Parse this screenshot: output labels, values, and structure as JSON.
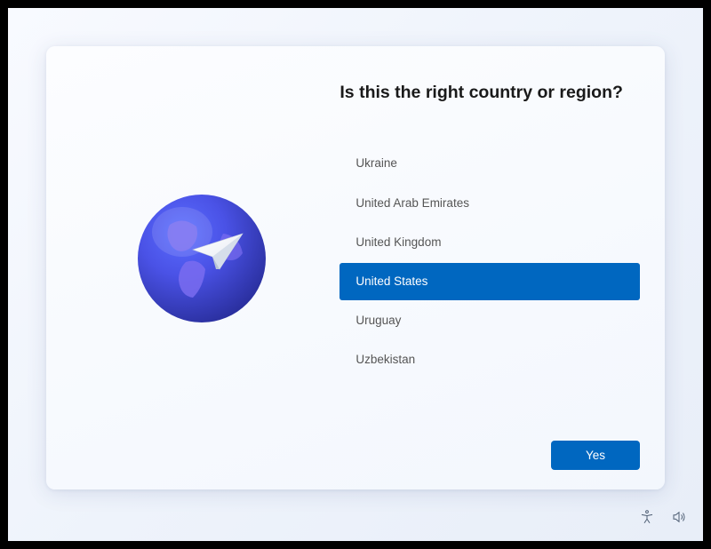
{
  "title": "Is this the right country or region?",
  "countries": {
    "items": [
      {
        "label": "Ukraine",
        "selected": false
      },
      {
        "label": "United Arab Emirates",
        "selected": false
      },
      {
        "label": "United Kingdom",
        "selected": false
      },
      {
        "label": "United States",
        "selected": true
      },
      {
        "label": "Uruguay",
        "selected": false
      },
      {
        "label": "Uzbekistan",
        "selected": false
      }
    ]
  },
  "actions": {
    "yes_label": "Yes"
  },
  "colors": {
    "accent": "#0067c0"
  }
}
